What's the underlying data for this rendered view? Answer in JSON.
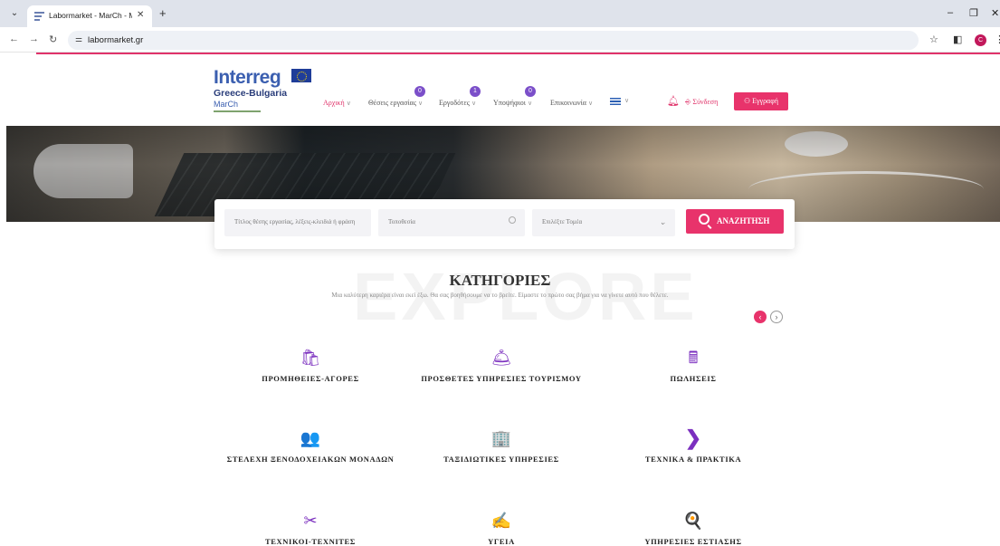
{
  "browser": {
    "tab_title": "Labormarket - MarCh - Market",
    "url": "labormarket.gr",
    "profile_initial": "C"
  },
  "logo": {
    "brand": "Interreg",
    "program": "Greece-Bulgaria",
    "project": "MarCh"
  },
  "nav": {
    "home": "Αρχική",
    "jobs": "Θέσεις εργασίας",
    "jobs_count": "0",
    "employers": "Εργοδότες",
    "employers_count": "1",
    "candidates": "Υποψήφιοι",
    "candidates_count": "0",
    "contact": "Επικοινωνία",
    "login": "Σύνδεση",
    "register": "Εγγραφή"
  },
  "search": {
    "keyword_placeholder": "Τίτλος θέσης εργασίας, λέξεις-κλειδιά ή φράση",
    "location_placeholder": "Τοποθεσία",
    "sector_placeholder": "Επιλέξτε Τομέα",
    "button_label": "ΑΝΑΖΗΤΗΣΗ"
  },
  "categories": {
    "background_word": "EXPLORE",
    "title": "ΚΑΤΗΓΟΡΙΕΣ",
    "subtitle": "Μια καλύτερη καριέρα είναι εκεί έξω. Θα σας βοηθήσουμε να το βρείτε. Είμαστε το πρώτο σας βήμα για να γίνετε αυτό που θέλετε.",
    "items": [
      {
        "label": "ΠΡΟΜΗΘΕΙΕΣ-ΑΓΟΡΕΣ",
        "icon": "shopping-bag-icon",
        "glyph": "🛍"
      },
      {
        "label": "ΠΡΟΣΘΕΤΕΣ ΥΠΗΡΕΣΙΕΣ ΤΟΥΡΙΣΜΟΥ",
        "icon": "room-service-icon",
        "glyph": "🛎"
      },
      {
        "label": "ΠΩΛΗΣΕΙΣ",
        "icon": "cash-register-icon",
        "glyph": "🖩"
      },
      {
        "label": "ΣΤΕΛΕΧΗ ΞΕΝΟΔΟΧΕΙΑΚΩΝ ΜΟΝΑΔΩΝ",
        "icon": "team-icon",
        "glyph": "👥"
      },
      {
        "label": "ΤΑΞΙΔΙΩΤΙΚΕΣ ΥΠΗΡΕΣΙΕΣ",
        "icon": "map-building-icon",
        "glyph": "🏢"
      },
      {
        "label": "ΤΕΧΝΙΚΑ & ΠΡΑΚΤΙΚΑ",
        "icon": "chevron-right-icon",
        "glyph": "❯"
      },
      {
        "label": "ΤΕΧΝΙΚΟΙ-ΤΕΧΝΙΤΕΣ",
        "icon": "tools-icon",
        "glyph": "✂"
      },
      {
        "label": "ΥΓΕΙΑ",
        "icon": "health-hand-icon",
        "glyph": "✍"
      },
      {
        "label": "ΥΠΗΡΕΣΙΕΣ ΕΣΤΙΑΣΗΣ",
        "icon": "kitchen-icon",
        "glyph": "🍳"
      }
    ]
  },
  "colors": {
    "accent": "#e8336b",
    "icon_purple": "#7b2fbf",
    "badge_purple": "#7b4fc9"
  }
}
